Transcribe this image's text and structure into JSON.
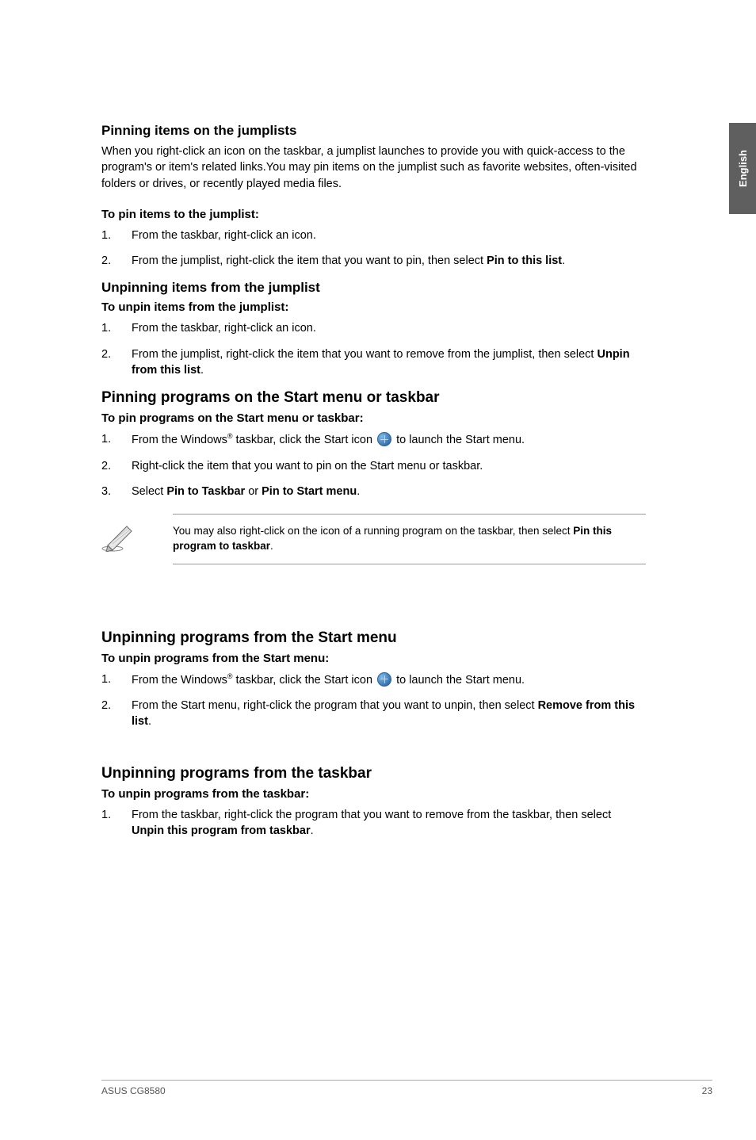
{
  "sideTab": "English",
  "sec1": {
    "title": "Pinning items on the jumplists",
    "intro": "When you right-click an icon on the taskbar, a jumplist launches to provide you with quick-access to the program's or item's related links.You may pin items on the jumplist such as favorite websites, often-visited folders or drives, or recently played media files.",
    "howTitle": "To pin items to the jumplist:",
    "steps": [
      "From the taskbar, right-click an icon.",
      {
        "pre": "From the jumplist, right-click the item that you want to pin, then select ",
        "bold": "Pin to this list",
        "post": "."
      }
    ]
  },
  "sec2": {
    "title": "Unpinning items from the jumplist",
    "howTitle": "To unpin items from the jumplist:",
    "steps": [
      "From the taskbar, right-click an icon.",
      {
        "pre": "From the jumplist, right-click the item that you want to remove from the jumplist, then select ",
        "bold": "Unpin from this list",
        "post": "."
      }
    ]
  },
  "sec3": {
    "title": "Pinning programs on the Start menu or taskbar",
    "howTitle": "To pin programs on the Start menu or taskbar:",
    "step1a": "From the Windows",
    "step1b": " taskbar, click the Start icon ",
    "step1c": " to launch the Start menu.",
    "step2": "Right-click the item that you want to pin on the Start menu or taskbar.",
    "step3pre": "Select ",
    "step3b1": "Pin to Taskbar",
    "step3mid": " or ",
    "step3b2": "Pin to Start menu",
    "step3post": "."
  },
  "note": {
    "pre": "You may also right-click on the icon of a running program on the taskbar, then select ",
    "bold": "Pin this program to taskbar",
    "post": "."
  },
  "sec4": {
    "title": "Unpinning programs from the Start menu",
    "howTitle": "To unpin programs from the Start menu:",
    "step1a": "From the Windows",
    "step1b": " taskbar, click the Start icon ",
    "step1c": " to launch the Start menu.",
    "step2pre": "From the Start menu, right-click the program that you want to unpin, then select ",
    "step2bold": "Remove from this list",
    "step2post": "."
  },
  "sec5": {
    "title": "Unpinning programs from the taskbar",
    "howTitle": "To unpin programs from the taskbar:",
    "step1pre": "From the taskbar, right-click the program that you want to remove from the taskbar, then select ",
    "step1bold": "Unpin this program from taskbar",
    "step1post": "."
  },
  "footer": {
    "left": "ASUS CG8580",
    "right": "23"
  },
  "nums": {
    "n1": "1.",
    "n2": "2.",
    "n3": "3."
  },
  "reg": "®"
}
